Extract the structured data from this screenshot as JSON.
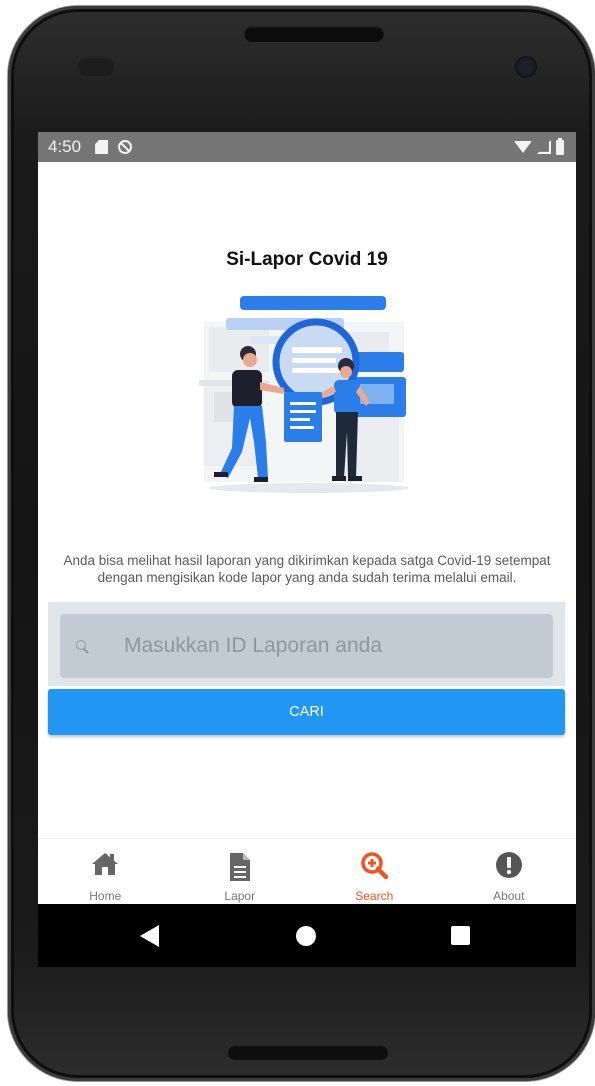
{
  "status_bar": {
    "time": "4:50"
  },
  "app": {
    "title": "Si-Lapor Covid 19",
    "description": "Anda bisa melihat hasil laporan yang dikirimkan kepada satga Covid-19 setempat dengan mengisikan kode lapor yang anda sudah terima melalui email."
  },
  "search": {
    "placeholder": "Masukkan ID Laporan anda",
    "value": ""
  },
  "button": {
    "label": "CARI",
    "color": "#2196f3"
  },
  "bottom_nav": {
    "active_color": "#f4511e",
    "items": [
      {
        "label": "Home",
        "icon": "home-icon"
      },
      {
        "label": "Lapor",
        "icon": "document-icon"
      },
      {
        "label": "Search",
        "icon": "zoom-in-icon",
        "active": true
      },
      {
        "label": "About",
        "icon": "exclamation-icon"
      }
    ]
  }
}
